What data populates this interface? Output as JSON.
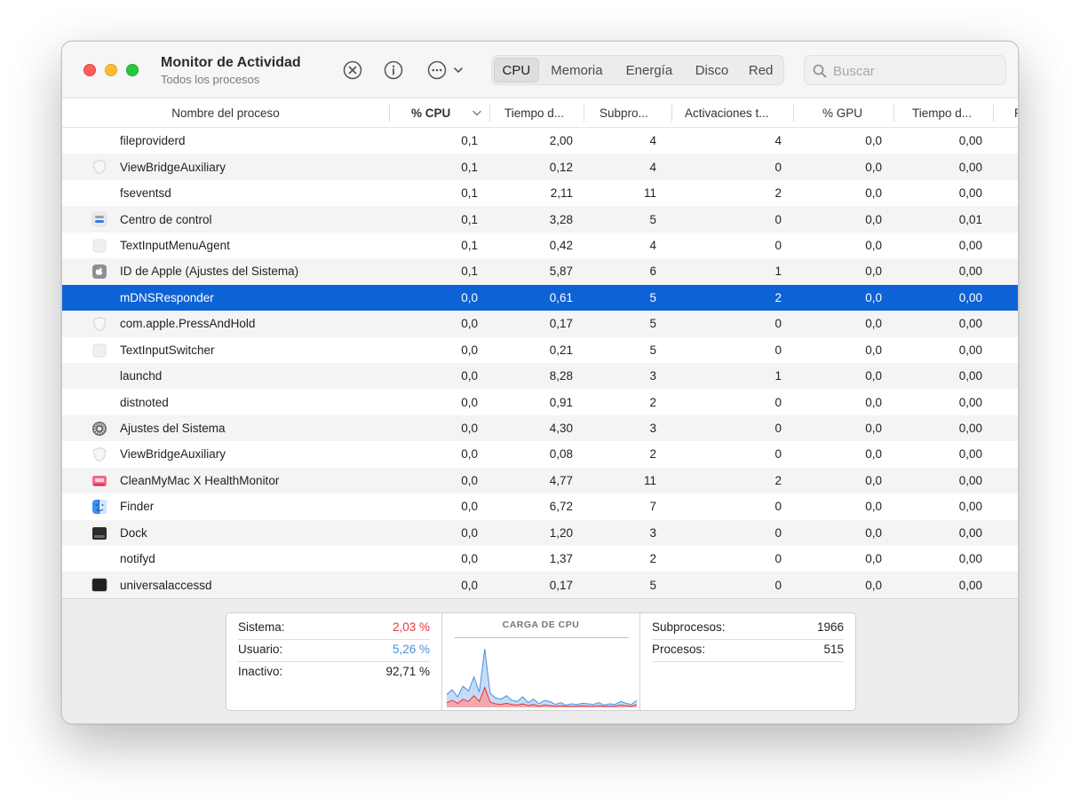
{
  "window": {
    "title": "Monitor de Actividad",
    "subtitle": "Todos los procesos"
  },
  "toolbar": {
    "stop_icon": "stop-process-icon",
    "info_icon": "info-icon",
    "more_icon": "ellipsis-menu-icon",
    "tabs": [
      {
        "label": "CPU",
        "active": true
      },
      {
        "label": "Memoria",
        "active": false
      },
      {
        "label": "Energía",
        "active": false
      },
      {
        "label": "Disco",
        "active": false
      },
      {
        "label": "Red",
        "active": false
      }
    ],
    "search_placeholder": "Buscar"
  },
  "table": {
    "columns": [
      "Nombre del proceso",
      "% CPU",
      "Tiempo d...",
      "Subpro...",
      "Activaciones t...",
      "% GPU",
      "Tiempo d...",
      "P"
    ],
    "sort_column": "% CPU",
    "rows": [
      {
        "icon": "none",
        "name": "fileproviderd",
        "cpu": "0,1",
        "time": "2,00",
        "threads": "4",
        "wakeups": "4",
        "gpu": "0,0",
        "gputime": "0,00",
        "selected": false
      },
      {
        "icon": "shield",
        "name": "ViewBridgeAuxiliary",
        "cpu": "0,1",
        "time": "0,12",
        "threads": "4",
        "wakeups": "0",
        "gpu": "0,0",
        "gputime": "0,00",
        "selected": false
      },
      {
        "icon": "none",
        "name": "fseventsd",
        "cpu": "0,1",
        "time": "2,11",
        "threads": "11",
        "wakeups": "2",
        "gpu": "0,0",
        "gputime": "0,00",
        "selected": false
      },
      {
        "icon": "control-center",
        "name": "Centro de control",
        "cpu": "0,1",
        "time": "3,28",
        "threads": "5",
        "wakeups": "0",
        "gpu": "0,0",
        "gputime": "0,01",
        "selected": false
      },
      {
        "icon": "blank",
        "name": "TextInputMenuAgent",
        "cpu": "0,1",
        "time": "0,42",
        "threads": "4",
        "wakeups": "0",
        "gpu": "0,0",
        "gputime": "0,00",
        "selected": false
      },
      {
        "icon": "apple",
        "name": "ID de Apple (Ajustes del Sistema)",
        "cpu": "0,1",
        "time": "5,87",
        "threads": "6",
        "wakeups": "1",
        "gpu": "0,0",
        "gputime": "0,00",
        "selected": false
      },
      {
        "icon": "none",
        "name": "mDNSResponder",
        "cpu": "0,0",
        "time": "0,61",
        "threads": "5",
        "wakeups": "2",
        "gpu": "0,0",
        "gputime": "0,00",
        "selected": true
      },
      {
        "icon": "shield",
        "name": "com.apple.PressAndHold",
        "cpu": "0,0",
        "time": "0,17",
        "threads": "5",
        "wakeups": "0",
        "gpu": "0,0",
        "gputime": "0,00",
        "selected": false
      },
      {
        "icon": "blank",
        "name": "TextInputSwitcher",
        "cpu": "0,0",
        "time": "0,21",
        "threads": "5",
        "wakeups": "0",
        "gpu": "0,0",
        "gputime": "0,00",
        "selected": false
      },
      {
        "icon": "none",
        "name": "launchd",
        "cpu": "0,0",
        "time": "8,28",
        "threads": "3",
        "wakeups": "1",
        "gpu": "0,0",
        "gputime": "0,00",
        "selected": false
      },
      {
        "icon": "none",
        "name": "distnoted",
        "cpu": "0,0",
        "time": "0,91",
        "threads": "2",
        "wakeups": "0",
        "gpu": "0,0",
        "gputime": "0,00",
        "selected": false
      },
      {
        "icon": "gear",
        "name": "Ajustes del Sistema",
        "cpu": "0,0",
        "time": "4,30",
        "threads": "3",
        "wakeups": "0",
        "gpu": "0,0",
        "gputime": "0,00",
        "selected": false
      },
      {
        "icon": "shield",
        "name": "ViewBridgeAuxiliary",
        "cpu": "0,0",
        "time": "0,08",
        "threads": "2",
        "wakeups": "0",
        "gpu": "0,0",
        "gputime": "0,00",
        "selected": false
      },
      {
        "icon": "cleanmymac",
        "name": "CleanMyMac X HealthMonitor",
        "cpu": "0,0",
        "time": "4,77",
        "threads": "11",
        "wakeups": "2",
        "gpu": "0,0",
        "gputime": "0,00",
        "selected": false
      },
      {
        "icon": "finder",
        "name": "Finder",
        "cpu": "0,0",
        "time": "6,72",
        "threads": "7",
        "wakeups": "0",
        "gpu": "0,0",
        "gputime": "0,00",
        "selected": false
      },
      {
        "icon": "dock",
        "name": "Dock",
        "cpu": "0,0",
        "time": "1,20",
        "threads": "3",
        "wakeups": "0",
        "gpu": "0,0",
        "gputime": "0,00",
        "selected": false
      },
      {
        "icon": "none",
        "name": "notifyd",
        "cpu": "0,0",
        "time": "1,37",
        "threads": "2",
        "wakeups": "0",
        "gpu": "0,0",
        "gputime": "0,00",
        "selected": false
      },
      {
        "icon": "terminal",
        "name": "universalaccessd",
        "cpu": "0,0",
        "time": "0,17",
        "threads": "5",
        "wakeups": "0",
        "gpu": "0,0",
        "gputime": "0,00",
        "selected": false
      }
    ]
  },
  "footer": {
    "sistema_label": "Sistema:",
    "sistema_value": "2,03 %",
    "usuario_label": "Usuario:",
    "usuario_value": "5,26 %",
    "inactivo_label": "Inactivo:",
    "inactivo_value": "92,71 %",
    "chart_title": "CARGA DE CPU",
    "subprocesos_label": "Subprocesos:",
    "subprocesos_value": "1966",
    "procesos_label": "Procesos:",
    "procesos_value": "515",
    "colors": {
      "sistema": "#e8343a",
      "usuario": "#4a90e2"
    },
    "cpu_load_user": [
      0.22,
      0.3,
      0.18,
      0.36,
      0.28,
      0.52,
      0.26,
      1.0,
      0.24,
      0.16,
      0.14,
      0.2,
      0.12,
      0.1,
      0.18,
      0.08,
      0.14,
      0.06,
      0.12,
      0.1,
      0.05,
      0.08,
      0.04,
      0.06,
      0.05,
      0.07,
      0.06,
      0.05,
      0.08,
      0.04,
      0.06,
      0.05,
      0.1,
      0.07,
      0.05,
      0.12
    ],
    "cpu_load_system": [
      0.08,
      0.12,
      0.07,
      0.14,
      0.1,
      0.2,
      0.1,
      0.34,
      0.09,
      0.06,
      0.05,
      0.07,
      0.05,
      0.04,
      0.06,
      0.03,
      0.05,
      0.02,
      0.04,
      0.03,
      0.02,
      0.03,
      0.02,
      0.02,
      0.02,
      0.03,
      0.02,
      0.02,
      0.03,
      0.02,
      0.02,
      0.02,
      0.04,
      0.03,
      0.02,
      0.05
    ]
  }
}
